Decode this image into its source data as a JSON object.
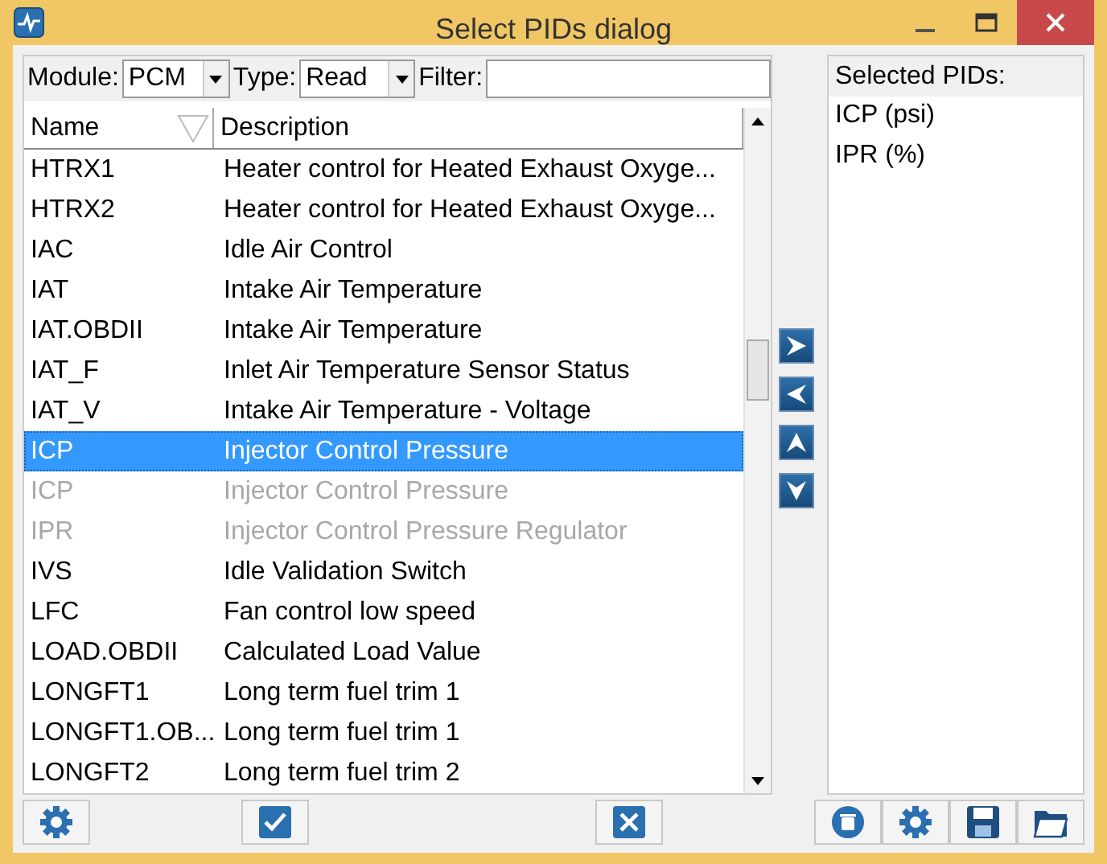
{
  "window": {
    "title": "Select PIDs dialog"
  },
  "filters": {
    "module_label": "Module:",
    "module_value": "PCM",
    "type_label": "Type:",
    "type_value": "Read",
    "filter_label": "Filter:"
  },
  "table": {
    "columns": [
      "Name",
      "Description"
    ],
    "rows": [
      {
        "name": "HTRX1",
        "description": "Heater control for Heated Exhaust Oxyge...",
        "selected": false,
        "disabled": false
      },
      {
        "name": "HTRX2",
        "description": "Heater control for Heated Exhaust Oxyge...",
        "selected": false,
        "disabled": false
      },
      {
        "name": "IAC",
        "description": "Idle Air Control",
        "selected": false,
        "disabled": false
      },
      {
        "name": "IAT",
        "description": "Intake Air Temperature",
        "selected": false,
        "disabled": false
      },
      {
        "name": "IAT.OBDII",
        "description": "Intake Air Temperature",
        "selected": false,
        "disabled": false
      },
      {
        "name": "IAT_F",
        "description": "Inlet Air Temperature Sensor Status",
        "selected": false,
        "disabled": false
      },
      {
        "name": "IAT_V",
        "description": "Intake Air Temperature - Voltage",
        "selected": false,
        "disabled": false
      },
      {
        "name": "ICP",
        "description": "Injector Control Pressure",
        "selected": true,
        "disabled": false
      },
      {
        "name": "ICP",
        "description": "Injector Control Pressure",
        "selected": false,
        "disabled": true
      },
      {
        "name": "IPR",
        "description": "Injector Control Pressure Regulator",
        "selected": false,
        "disabled": true
      },
      {
        "name": "IVS",
        "description": "Idle Validation Switch",
        "selected": false,
        "disabled": false
      },
      {
        "name": "LFC",
        "description": "Fan control low speed",
        "selected": false,
        "disabled": false
      },
      {
        "name": "LOAD.OBDII",
        "description": "Calculated Load Value",
        "selected": false,
        "disabled": false
      },
      {
        "name": "LONGFT1",
        "description": "Long term fuel trim 1",
        "selected": false,
        "disabled": false
      },
      {
        "name": "LONGFT1.OB...",
        "description": "Long term fuel trim 1",
        "selected": false,
        "disabled": false
      },
      {
        "name": "LONGFT2",
        "description": "Long term fuel trim 2",
        "selected": false,
        "disabled": false
      }
    ]
  },
  "selected_pids": {
    "header": "Selected PIDs:",
    "items": [
      "ICP (psi)",
      "IPR (%)"
    ]
  }
}
